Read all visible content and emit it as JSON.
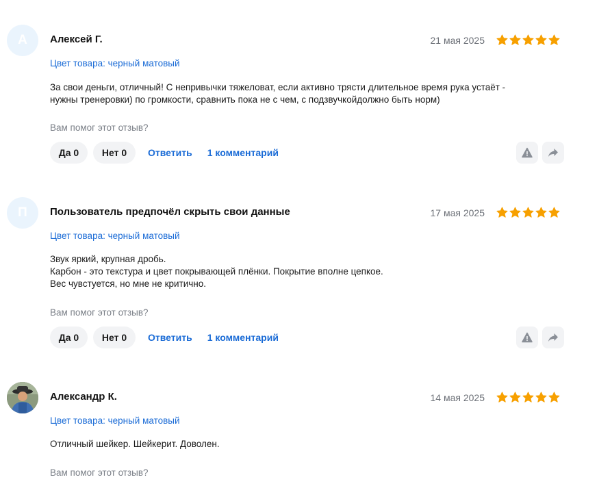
{
  "reviews": [
    {
      "avatar_letter": "А",
      "author": "Алексей Г.",
      "date": "21 мая 2025",
      "rating": 5,
      "variant": "Цвет товара: черный матовый",
      "text_lines": [
        "За свои деньги, отличный! С непривычки тяжеловат, если активно трясти длительное время рука устаёт -",
        "нужны тренеровки) по громкости, сравнить пока не с чем, с подзвучкойдолжно быть норм)"
      ],
      "helpful_question": "Вам помог этот отзыв?",
      "yes_label": "Да 0",
      "no_label": "Нет 0",
      "reply_label": "Ответить",
      "comments_label": "1 комментарий"
    },
    {
      "avatar_letter": "П",
      "author": "Пользователь предпочёл скрыть свои данные",
      "date": "17 мая 2025",
      "rating": 5,
      "variant": "Цвет товара: черный матовый",
      "text_lines": [
        "Звук яркий, крупная дробь.",
        "Карбон - это текстура и цвет покрывающей плёнки. Покрытие вполне цепкое.",
        "Вес чувстуется, но мне не критично."
      ],
      "helpful_question": "Вам помог этот отзыв?",
      "yes_label": "Да 0",
      "no_label": "Нет 0",
      "reply_label": "Ответить",
      "comments_label": "1 комментарий"
    },
    {
      "author": "Александр К.",
      "date": "14 мая 2025",
      "rating": 5,
      "variant": "Цвет товара: черный матовый",
      "text_lines": [
        "Отличный шейкер. Шейкерит. Доволен."
      ],
      "helpful_question": "Вам помог этот отзыв?"
    }
  ],
  "colors": {
    "star": "#f7a000",
    "link": "#1a6bd6",
    "pill_bg": "#f2f3f5",
    "avatar_bg": "#eaf4fd"
  },
  "icons": {
    "report": "warning-icon",
    "share": "share-icon",
    "star": "star-icon"
  }
}
